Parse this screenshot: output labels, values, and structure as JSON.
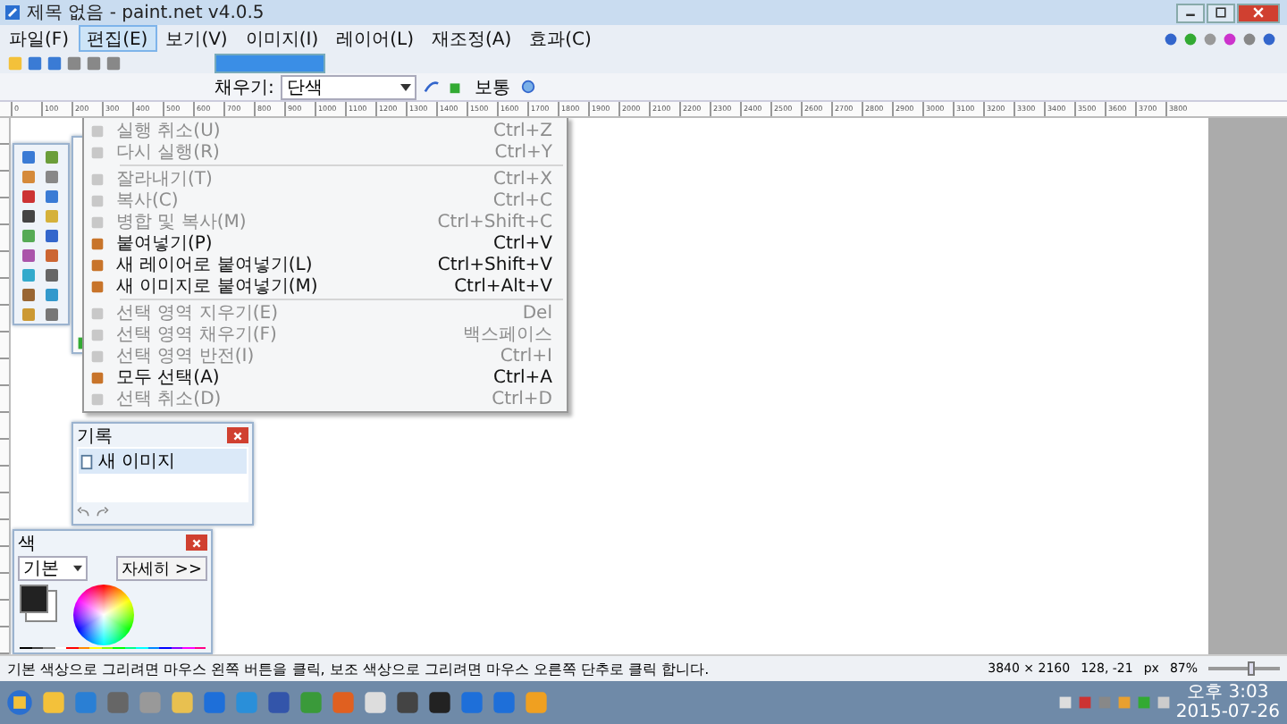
{
  "window": {
    "title": "제목 없음 - paint.net v4.0.5"
  },
  "menu_bar": [
    {
      "label": "파일(F)",
      "selected": false
    },
    {
      "label": "편집(E)",
      "selected": true
    },
    {
      "label": "보기(V)",
      "selected": false
    },
    {
      "label": "이미지(I)",
      "selected": false
    },
    {
      "label": "레이어(L)",
      "selected": false
    },
    {
      "label": "재조정(A)",
      "selected": false
    },
    {
      "label": "효과(C)",
      "selected": false
    }
  ],
  "edit_menu": {
    "groups": [
      [
        {
          "label": "실행 취소(U)",
          "shortcut": "Ctrl+Z",
          "disabled": true
        },
        {
          "label": "다시 실행(R)",
          "shortcut": "Ctrl+Y",
          "disabled": true
        }
      ],
      [
        {
          "label": "잘라내기(T)",
          "shortcut": "Ctrl+X",
          "disabled": true
        },
        {
          "label": "복사(C)",
          "shortcut": "Ctrl+C",
          "disabled": true
        },
        {
          "label": "병합 및 복사(M)",
          "shortcut": "Ctrl+Shift+C",
          "disabled": true
        },
        {
          "label": "붙여넣기(P)",
          "shortcut": "Ctrl+V",
          "disabled": false
        },
        {
          "label": "새 레이어로 붙여넣기(L)",
          "shortcut": "Ctrl+Shift+V",
          "disabled": false
        },
        {
          "label": "새 이미지로 붙여넣기(M)",
          "shortcut": "Ctrl+Alt+V",
          "disabled": false
        }
      ],
      [
        {
          "label": "선택 영역 지우기(E)",
          "shortcut": "Del",
          "disabled": true
        },
        {
          "label": "선택 영역 채우기(F)",
          "shortcut": "백스페이스",
          "disabled": true
        },
        {
          "label": "선택 영역 반전(I)",
          "shortcut": "Ctrl+I",
          "disabled": true
        },
        {
          "label": "모두 선택(A)",
          "shortcut": "Ctrl+A",
          "disabled": false
        },
        {
          "label": "선택 취소(D)",
          "shortcut": "Ctrl+D",
          "disabled": true
        }
      ]
    ]
  },
  "toolbar": {
    "fill_label": "채우기:",
    "fill_value": "단색",
    "blend_value": "보통"
  },
  "ruler_labels": [
    "0",
    "100",
    "200",
    "300",
    "400",
    "500",
    "600",
    "700",
    "800",
    "900",
    "1000",
    "1100",
    "1200",
    "1300",
    "1400",
    "1500",
    "1600",
    "1700",
    "1800",
    "1900",
    "2000",
    "2100",
    "2200",
    "2300",
    "2400",
    "2500",
    "2600",
    "2700",
    "2800",
    "2900",
    "3000",
    "3100",
    "3200",
    "3300",
    "3400",
    "3500",
    "3600",
    "3700",
    "3800"
  ],
  "history_panel": {
    "title": "기록",
    "items": [
      "새 이미지"
    ]
  },
  "colors_panel": {
    "title": "색",
    "mode": "기본",
    "more_button": "자세히 >>"
  },
  "status_bar": {
    "hint": "기본 색상으로 그리려면 마우스 왼쪽 버튼을 클릭, 보조 색상으로 그리려면 마우스 오른쪽 단추로 클릭 합니다.",
    "size": "3840 × 2160",
    "cursor": "128, -21",
    "unit": "px",
    "zoom": "87%",
    "zoom_slider": {
      "level": 0.6
    }
  },
  "taskbar": {
    "clock": {
      "time": "오후 3:03",
      "date": "2015-07-26"
    }
  }
}
